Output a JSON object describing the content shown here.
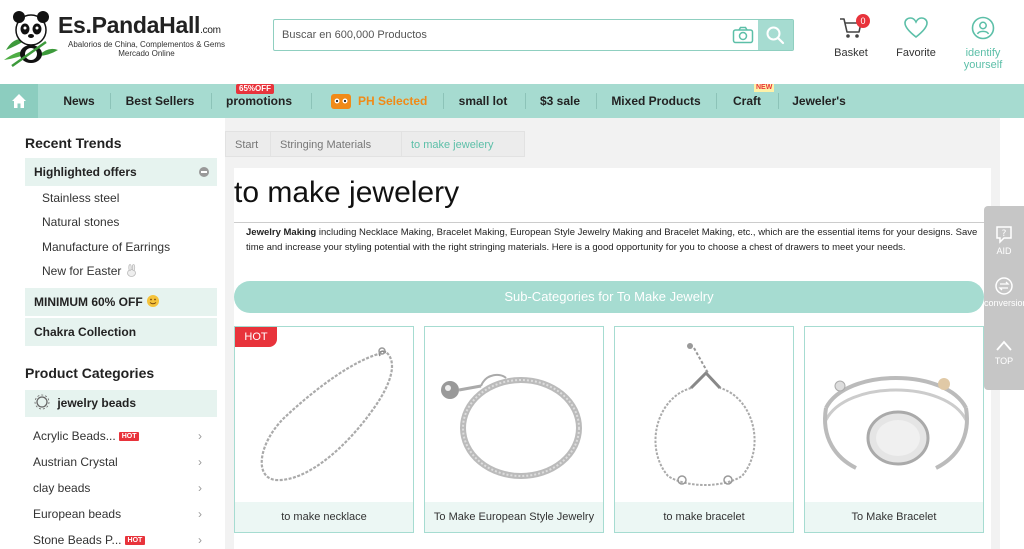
{
  "header": {
    "logo_name": "Es.PandaHall",
    "logo_com": ".com",
    "logo_tagline": "Abalorios de China, Complementos & Gems Mercado Online",
    "search_placeholder": "Buscar en 600,000 Productos",
    "basket_label": "Basket",
    "basket_count": "0",
    "favorite_label": "Favorite",
    "identify_label": "identify yourself"
  },
  "nav": {
    "items": [
      "News",
      "Best Sellers",
      "promotions",
      "PH Selected",
      "small lot",
      "$3 sale",
      "Mixed Products",
      "Craft",
      "Jeweler's"
    ],
    "promo_tag": "65%OFF",
    "new_tag": "NEW"
  },
  "sidebar": {
    "recent_title": "Recent Trends",
    "highlighted": "Highlighted offers",
    "links": [
      "Stainless steel",
      "Natural stones",
      "Manufacture of Earrings",
      "New for Easter"
    ],
    "minimum": "MINIMUM 60% OFF",
    "chakra": "Chakra Collection",
    "categories_title": "Product Categories",
    "jewelry_beads": "jewelry beads",
    "categories": [
      "Acrylic Beads...",
      "Austrian Crystal",
      "clay beads",
      "European beads",
      "Stone Beads P..."
    ],
    "hot_label": "HOT"
  },
  "breadcrumb": [
    "Start",
    "Stringing Materials",
    "to make jewelery"
  ],
  "page": {
    "title": "to make jewelery",
    "desc_bold": "Jewelry Making",
    "desc_rest": " including Necklace Making, Bracelet Making, European Style Jewelry Making and Bracelet Making, etc., which are the essential items for your designs. Save time and increase your styling potential with the right stringing materials. Here is a good opportunity for you to choose a chest of drawers to meet your needs.",
    "subcat_title": "Sub-Categories for To Make Jewelry",
    "hot_tag": "HOT",
    "products": [
      "to make necklace",
      "To Make European Style Jewelry",
      "to make bracelet",
      "To Make Bracelet"
    ]
  },
  "float": {
    "aid": "AID",
    "conversion": "conversion",
    "top": "TOP"
  },
  "colors": {
    "accent": "#a6dcd1",
    "accent_text": "#5cbfa8",
    "hot": "#e8333b",
    "orange": "#f08a17"
  }
}
